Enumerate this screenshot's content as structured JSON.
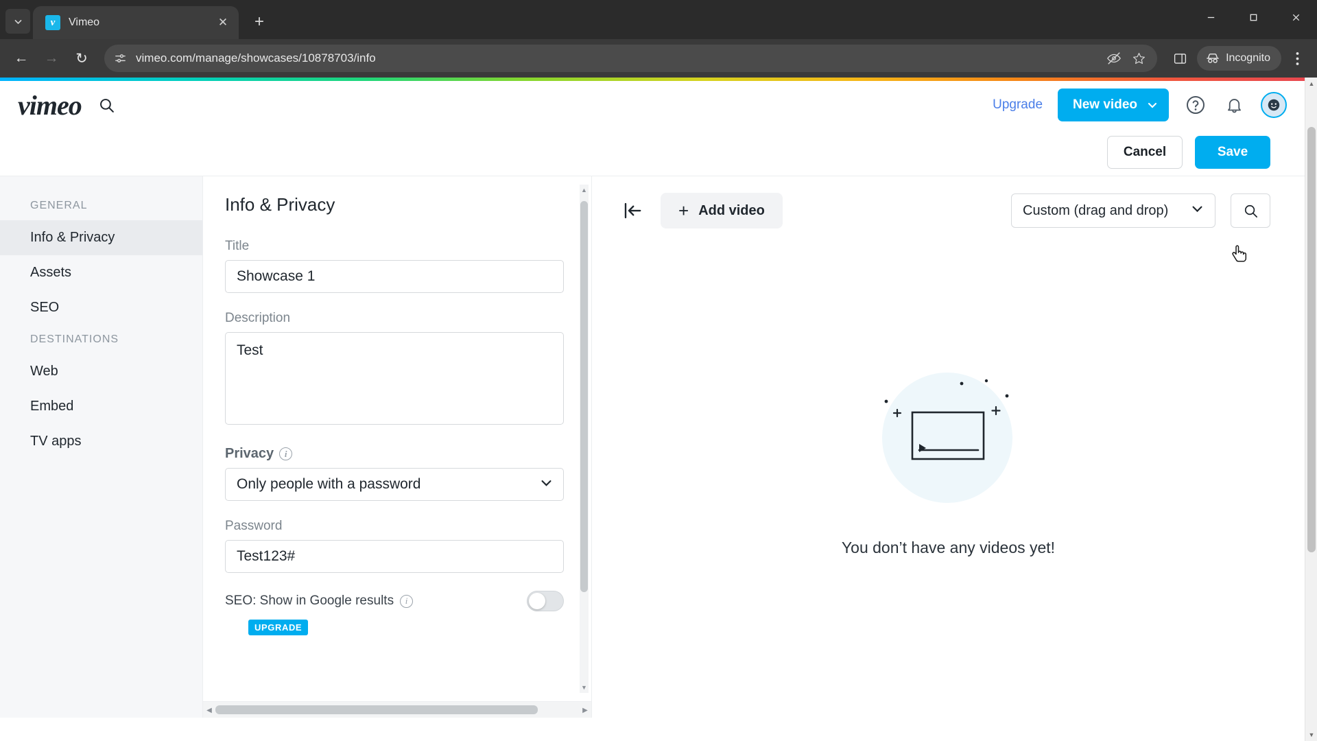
{
  "browser": {
    "tab": {
      "title": "Vimeo",
      "favicon_letter": "v"
    },
    "tab_list_icon": "chevron-down-icon",
    "new_tab_label": "+",
    "window_controls": {
      "minimize": "—",
      "maximize": "☐",
      "close": "✕"
    },
    "nav": {
      "back": "←",
      "forward": "→",
      "reload": "↻"
    },
    "omnibox": {
      "url": "vimeo.com/manage/showcases/10878703/info",
      "site_info_icon": "page-settings-icon",
      "tracking_icon": "eye-off-icon",
      "bookmark_icon": "star-icon",
      "sidepanel_icon": "side-panel-icon"
    },
    "incognito_label": "Incognito",
    "menu_icon": "kebab-menu-icon"
  },
  "site_header": {
    "logo": "vimeo",
    "search_icon": "search-icon",
    "upgrade_label": "Upgrade",
    "new_video_label": "New video",
    "new_video_chevron": "chevron-down-icon",
    "help_icon": "help-circle-icon",
    "notifications_icon": "bell-icon",
    "avatar_icon": "user-avatar"
  },
  "action_bar": {
    "cancel_label": "Cancel",
    "save_label": "Save"
  },
  "sidebar": {
    "groups": [
      {
        "title": "GENERAL",
        "items": [
          {
            "label": "Info & Privacy",
            "active": true
          },
          {
            "label": "Assets",
            "active": false
          },
          {
            "label": "SEO",
            "active": false
          }
        ]
      },
      {
        "title": "DESTINATIONS",
        "items": [
          {
            "label": "Web",
            "active": false
          },
          {
            "label": "Embed",
            "active": false
          },
          {
            "label": "TV apps",
            "active": false
          }
        ]
      }
    ]
  },
  "form": {
    "heading": "Info & Privacy",
    "title": {
      "label": "Title",
      "value": "Showcase 1"
    },
    "description": {
      "label": "Description",
      "value": "Test"
    },
    "privacy": {
      "label": "Privacy",
      "info_icon": "info-icon",
      "value": "Only people with a password",
      "chevron": "chevron-down-icon"
    },
    "password": {
      "label": "Password",
      "value": "Test123#"
    },
    "seo": {
      "label": "SEO: Show in Google results",
      "info_icon": "info-icon",
      "toggle_on": false,
      "badge": "UPGRADE"
    }
  },
  "videos_panel": {
    "collapse_icon": "collapse-left-icon",
    "add_video_label": "Add video",
    "add_video_plus": "+",
    "sort_value": "Custom (drag and drop)",
    "sort_chevron": "chevron-down-icon",
    "search_icon": "search-icon",
    "empty_message": "You don’t have any videos yet!",
    "empty_art": "empty-video-illustration"
  },
  "colors": {
    "brand_blue": "#00adef",
    "upgrade_link": "#4a7ee8",
    "sidebar_bg": "#f6f7f9",
    "chrome_dark": "#2b2b2b"
  }
}
